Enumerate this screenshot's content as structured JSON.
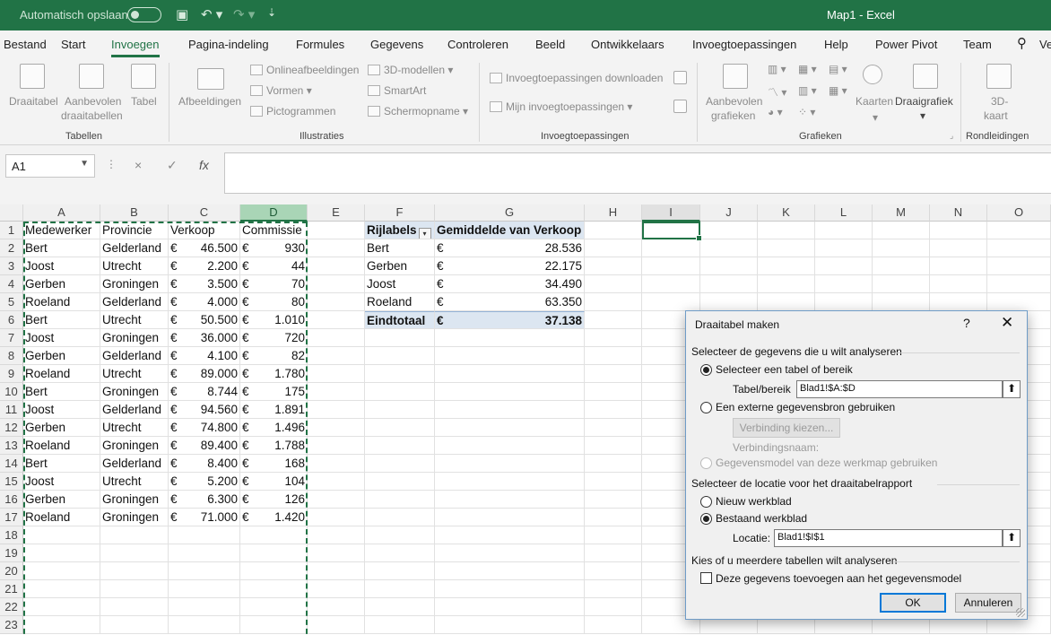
{
  "titlebar": {
    "autosave_label": "Automatisch opslaan",
    "save_icon": "save-icon",
    "undo_icon": "undo-icon",
    "redo_icon": "redo-icon",
    "customize_icon": "customize-qat-icon",
    "document_title": "Map1  -  Excel",
    "bg_color": "#217346"
  },
  "menu": {
    "tabs": [
      "Bestand",
      "Start",
      "Invoegen",
      "Pagina-indeling",
      "Formules",
      "Gegevens",
      "Controleren",
      "Beeld",
      "Ontwikkelaars",
      "Invoegtoepassingen",
      "Help",
      "Power Pivot",
      "Team"
    ],
    "active_tab": "Invoegen",
    "search_icon": "search-icon",
    "search_label": "Ve"
  },
  "ribbon": {
    "tabellen": {
      "draaitabel": "Draaitabel",
      "aanbevolen_1": "Aanbevolen",
      "aanbevolen_2": "draaitabellen",
      "tabel": "Tabel",
      "group": "Tabellen"
    },
    "illustraties": {
      "afbeeldingen": "Afbeeldingen",
      "online": "Onlineafbeeldingen",
      "vormen": "Vormen",
      "pictogrammen": "Pictogrammen",
      "modellen": "3D-modellen",
      "smartart": "SmartArt",
      "schermopname": "Schermopname",
      "group": "Illustraties"
    },
    "invoegtoepassingen": {
      "downloaden": "Invoegtoepassingen downloaden",
      "mijn": "Mijn invoegtoepassingen",
      "group": "Invoegtoepassingen"
    },
    "grafieken": {
      "aanbevolen_1": "Aanbevolen",
      "aanbevolen_2": "grafieken",
      "kaarten": "Kaarten",
      "draaigrafiek": "Draaigrafiek",
      "group": "Grafieken"
    },
    "rondleidingen": {
      "kaart_1": "3D-",
      "kaart_2": "kaart",
      "group": "Rondleidingen"
    }
  },
  "formula_bar": {
    "name_box": "A1",
    "cancel_icon": "×",
    "enter_icon": "✓",
    "fx": "fx",
    "formula": ""
  },
  "sheet": {
    "columns": [
      "A",
      "B",
      "C",
      "D",
      "E",
      "F",
      "G",
      "H",
      "I",
      "J",
      "K",
      "L",
      "M",
      "N",
      "O"
    ],
    "rows": [
      "1",
      "2",
      "3",
      "4",
      "5",
      "6",
      "7",
      "8",
      "9",
      "10",
      "11",
      "12",
      "13",
      "14",
      "15",
      "16",
      "17",
      "18",
      "19",
      "20",
      "21",
      "22",
      "23"
    ],
    "headers": [
      "Medewerker",
      "Provincie",
      "Verkoop",
      "Commissie"
    ],
    "data": [
      [
        "Bert",
        "Gelderland",
        "46.500",
        "930"
      ],
      [
        "Joost",
        "Utrecht",
        "2.200",
        "44"
      ],
      [
        "Gerben",
        "Groningen",
        "3.500",
        "70"
      ],
      [
        "Roeland",
        "Gelderland",
        "4.000",
        "80"
      ],
      [
        "Bert",
        "Utrecht",
        "50.500",
        "1.010"
      ],
      [
        "Joost",
        "Groningen",
        "36.000",
        "720"
      ],
      [
        "Gerben",
        "Gelderland",
        "4.100",
        "82"
      ],
      [
        "Roeland",
        "Utrecht",
        "89.000",
        "1.780"
      ],
      [
        "Bert",
        "Groningen",
        "8.744",
        "175"
      ],
      [
        "Joost",
        "Gelderland",
        "94.560",
        "1.891"
      ],
      [
        "Gerben",
        "Utrecht",
        "74.800",
        "1.496"
      ],
      [
        "Roeland",
        "Groningen",
        "89.400",
        "1.788"
      ],
      [
        "Bert",
        "Gelderland",
        "8.400",
        "168"
      ],
      [
        "Joost",
        "Utrecht",
        "5.200",
        "104"
      ],
      [
        "Gerben",
        "Groningen",
        "6.300",
        "126"
      ],
      [
        "Roeland",
        "Groningen",
        "71.000",
        "1.420"
      ]
    ],
    "currency": "€",
    "pivot": {
      "header_rows": "Rijlabels",
      "header_value": "Gemiddelde van Verkoop",
      "rows": [
        [
          "Bert",
          "28.536"
        ],
        [
          "Gerben",
          "22.175"
        ],
        [
          "Joost",
          "34.490"
        ],
        [
          "Roeland",
          "63.350"
        ]
      ],
      "total_label": "Eindtotaal",
      "total_value": "37.138",
      "header_color": "#dce6f1"
    }
  },
  "dialog": {
    "title": "Draaitabel maken",
    "help": "?",
    "close": "✕",
    "section1": "Selecteer de gegevens die u wilt analyseren",
    "option_range": "Selecteer een tabel of bereik",
    "range_label": "Tabel/bereik",
    "range_value": "Blad1!$A:$D",
    "option_external": "Een externe gegevensbron gebruiken",
    "connection_button": "Verbinding kiezen...",
    "connection_name": "Verbindingsnaam:",
    "option_model": "Gegevensmodel van deze werkmap gebruiken",
    "section2": "Selecteer de locatie voor het draaitabelrapport",
    "option_new": "Nieuw werkblad",
    "option_existing": "Bestaand werkblad",
    "location_label": "Locatie:",
    "location_value": "Blad1!$I$1",
    "section3": "Kies of u meerdere tabellen wilt analyseren",
    "add_to_model": "Deze gegevens toevoegen aan het gegevensmodel",
    "ok": "OK",
    "cancel": "Annuleren",
    "collapse_icon": "⬆"
  }
}
